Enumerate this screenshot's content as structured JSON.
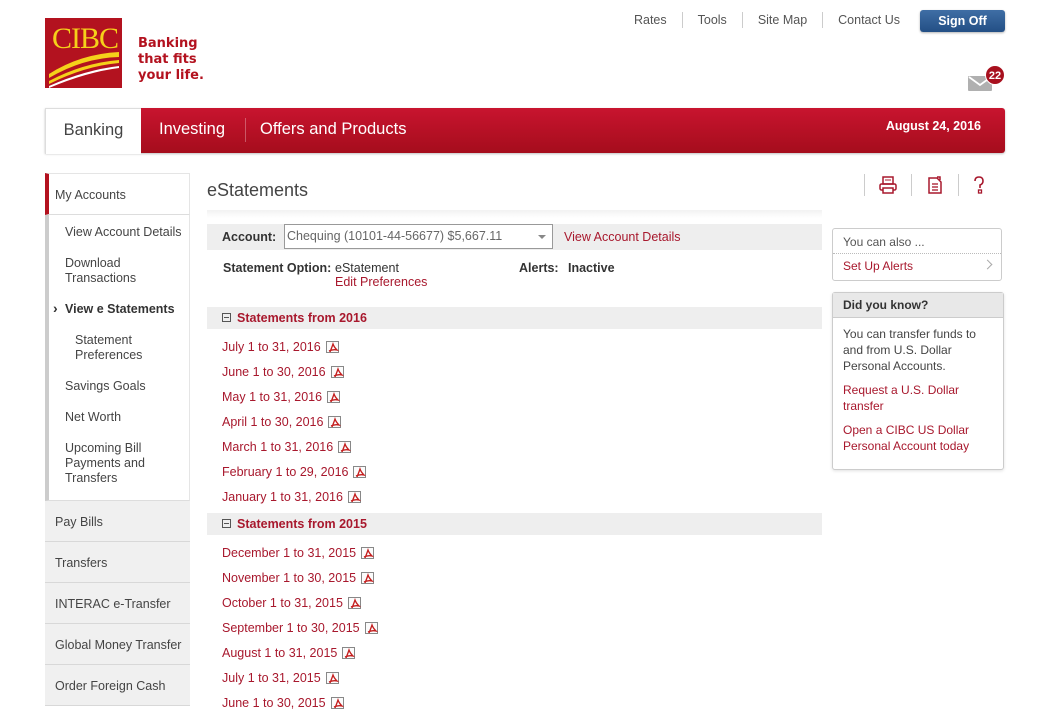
{
  "brand": {
    "logo_text": "CIBC",
    "tagline": [
      "Banking",
      "that fits",
      "your life."
    ],
    "colors": {
      "primary_red": "#b3121f",
      "link_red": "#a8182d",
      "logo_yellow": "#f5d11a",
      "signoff_blue": "#2f5f98"
    }
  },
  "top_links": [
    {
      "label": "Rates"
    },
    {
      "label": "Tools"
    },
    {
      "label": "Site Map"
    },
    {
      "label": "Contact Us"
    }
  ],
  "signoff_label": "Sign Off",
  "messages": {
    "icon": "mail-icon",
    "count": "22"
  },
  "main_nav": {
    "tabs": [
      {
        "label": "Banking",
        "active": true
      },
      {
        "label": "Investing"
      },
      {
        "label": "Offers and Products"
      }
    ],
    "date": "August 24, 2016"
  },
  "sidebar": {
    "section_title": "My Accounts",
    "sub_items": [
      {
        "label": "View Account Details"
      },
      {
        "label": "Download Transactions"
      },
      {
        "label": "View e Statements",
        "active": true
      },
      {
        "label": "Statement Preferences",
        "nested": true
      },
      {
        "label": "Savings Goals"
      },
      {
        "label": "Net Worth"
      },
      {
        "label": "Upcoming Bill Payments and Transfers"
      }
    ],
    "items": [
      {
        "label": "Pay Bills"
      },
      {
        "label": "Transfers"
      },
      {
        "label": "INTERAC e-Transfer"
      },
      {
        "label": "Global Money Transfer"
      },
      {
        "label": "Order Foreign Cash"
      }
    ]
  },
  "content": {
    "title": "eStatements",
    "tool_icons": [
      "print-icon",
      "notes-icon",
      "help-icon"
    ],
    "account_label": "Account:",
    "account_value": "Chequing (10101-44-56677) $5,667.11",
    "account_link": "View Account Details",
    "statement_option_label": "Statement Option:",
    "statement_option_value": "eStatement",
    "edit_preferences": "Edit Preferences",
    "alerts_label": "Alerts:",
    "alerts_value": "Inactive",
    "sections": [
      {
        "title": "Statements from 2016",
        "statements": [
          "July 1 to 31, 2016",
          "June 1 to 30, 2016",
          "May 1 to 31, 2016",
          "April 1 to 30, 2016",
          "March 1 to 31, 2016",
          "February 1 to 29, 2016",
          "January 1 to 31, 2016"
        ]
      },
      {
        "title": "Statements from 2015",
        "statements": [
          "December 1 to 31, 2015",
          "November 1 to 30, 2015",
          "October 1 to 31, 2015",
          "September 1 to 30, 2015",
          "August 1 to 31, 2015",
          "July 1 to 31, 2015",
          "June 1 to 30, 2015"
        ]
      }
    ]
  },
  "right": {
    "also_title": "You can also ...",
    "also_link": "Set Up Alerts",
    "dyk_title": "Did you know?",
    "dyk_text": "You can transfer funds to and from U.S. Dollar Personal Accounts.",
    "dyk_links": [
      "Request a U.S. Dollar transfer",
      "Open a CIBC US Dollar Personal Account today"
    ]
  }
}
